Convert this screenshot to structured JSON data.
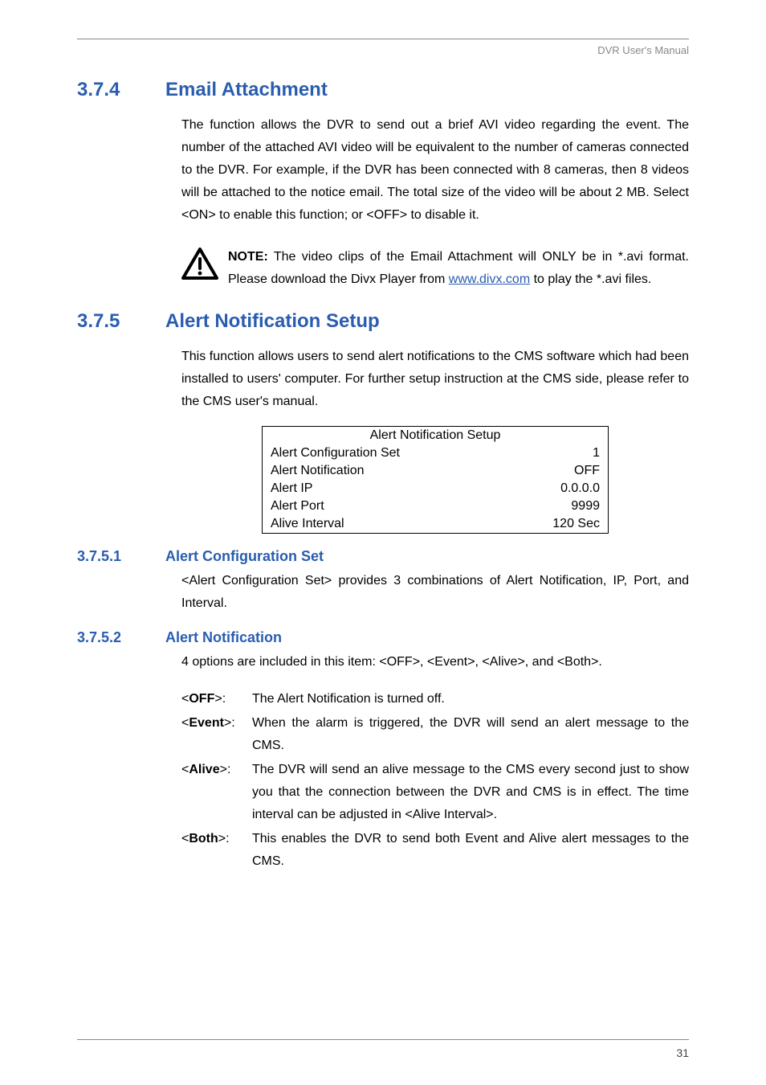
{
  "header": {
    "right": "DVR User's Manual"
  },
  "s374": {
    "num": "3.7.4",
    "title": "Email Attachment",
    "para": "The function allows the DVR to send out a brief AVI video regarding the event. The number of the attached AVI video will be equivalent to the number of cameras connected to the DVR. For example, if the DVR has been connected with 8 cameras, then 8 videos will be attached to the notice email. The total size of the video will be about 2 MB. Select <ON> to enable this function; or <OFF> to disable it.",
    "note_label": "NOTE:",
    "note_before": " The video clips of the Email Attachment will ONLY be in *.avi format. Please download the Divx Player from ",
    "note_link": "www.divx.com",
    "note_after": " to play the *.avi files."
  },
  "s375": {
    "num": "3.7.5",
    "title": "Alert Notification Setup",
    "para": "This function allows users to send alert notifications to the CMS software which had been installed to users' computer. For further setup instruction at the CMS side, please refer to the CMS user's manual.",
    "table": {
      "title": "Alert Notification Setup",
      "rows": [
        {
          "label": "Alert Configuration Set",
          "value": "1"
        },
        {
          "label": "Alert Notification",
          "value": "OFF"
        },
        {
          "label": "Alert IP",
          "value": "0.0.0.0"
        },
        {
          "label": "Alert Port",
          "value": "9999"
        },
        {
          "label": "Alive Interval",
          "value": "120  Sec"
        }
      ]
    }
  },
  "s3751": {
    "num": "3.7.5.1",
    "title": "Alert Configuration Set",
    "para": "<Alert Configuration Set> provides 3 combinations of Alert Notification, IP, Port, and Interval."
  },
  "s3752": {
    "num": "3.7.5.2",
    "title": "Alert Notification",
    "intro": "4 options are included in this item: <OFF>, <Event>, <Alive>, and <Both>.",
    "opts": {
      "off": {
        "label": "<OFF>:",
        "text": "The Alert Notification is turned off."
      },
      "event": {
        "label": "<Event>:",
        "text": "When the alarm is triggered, the DVR will send an alert message to the CMS."
      },
      "alive": {
        "label": "<Alive>:",
        "text": "The DVR will send an alive message to the CMS every    second just to show you that the connection between the DVR and CMS is in effect. The time interval    can be adjusted in <Alive Interval>."
      },
      "both": {
        "label": "<Both>:",
        "text": "This enables the DVR to send both Event and Alive alert messages to the CMS."
      }
    }
  },
  "page_number": "31"
}
